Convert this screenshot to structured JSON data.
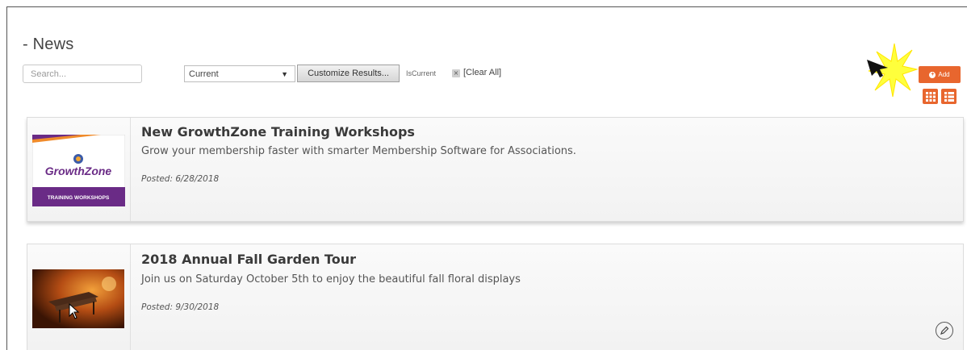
{
  "page": {
    "title": "- News"
  },
  "toolbar": {
    "search_placeholder": "Search...",
    "filter_selected": "Current",
    "customize_label": "Customize Results...",
    "active_filter": "IsCurrent",
    "clear_all_label": "[Clear All]",
    "add_label": "Add",
    "accent_color": "#e8662e"
  },
  "news": [
    {
      "title": "New GrowthZone Training Workshops",
      "description": "Grow your membership faster with smarter Membership Software for Associations.",
      "posted": "Posted: 6/28/2018",
      "thumb": {
        "brand": "GrowthZone",
        "caption": "TRAINING WORKSHOPS"
      }
    },
    {
      "title": "2018 Annual Fall Garden Tour",
      "description": "Join us on Saturday October 5th to enjoy the beautiful fall floral displays",
      "posted": "Posted: 9/30/2018"
    }
  ],
  "icons": {
    "add": "plus-circle-icon",
    "grid_view": "grid-view-icon",
    "list_view": "list-view-icon",
    "edit": "pencil-icon",
    "remove_filter": "close-icon"
  }
}
